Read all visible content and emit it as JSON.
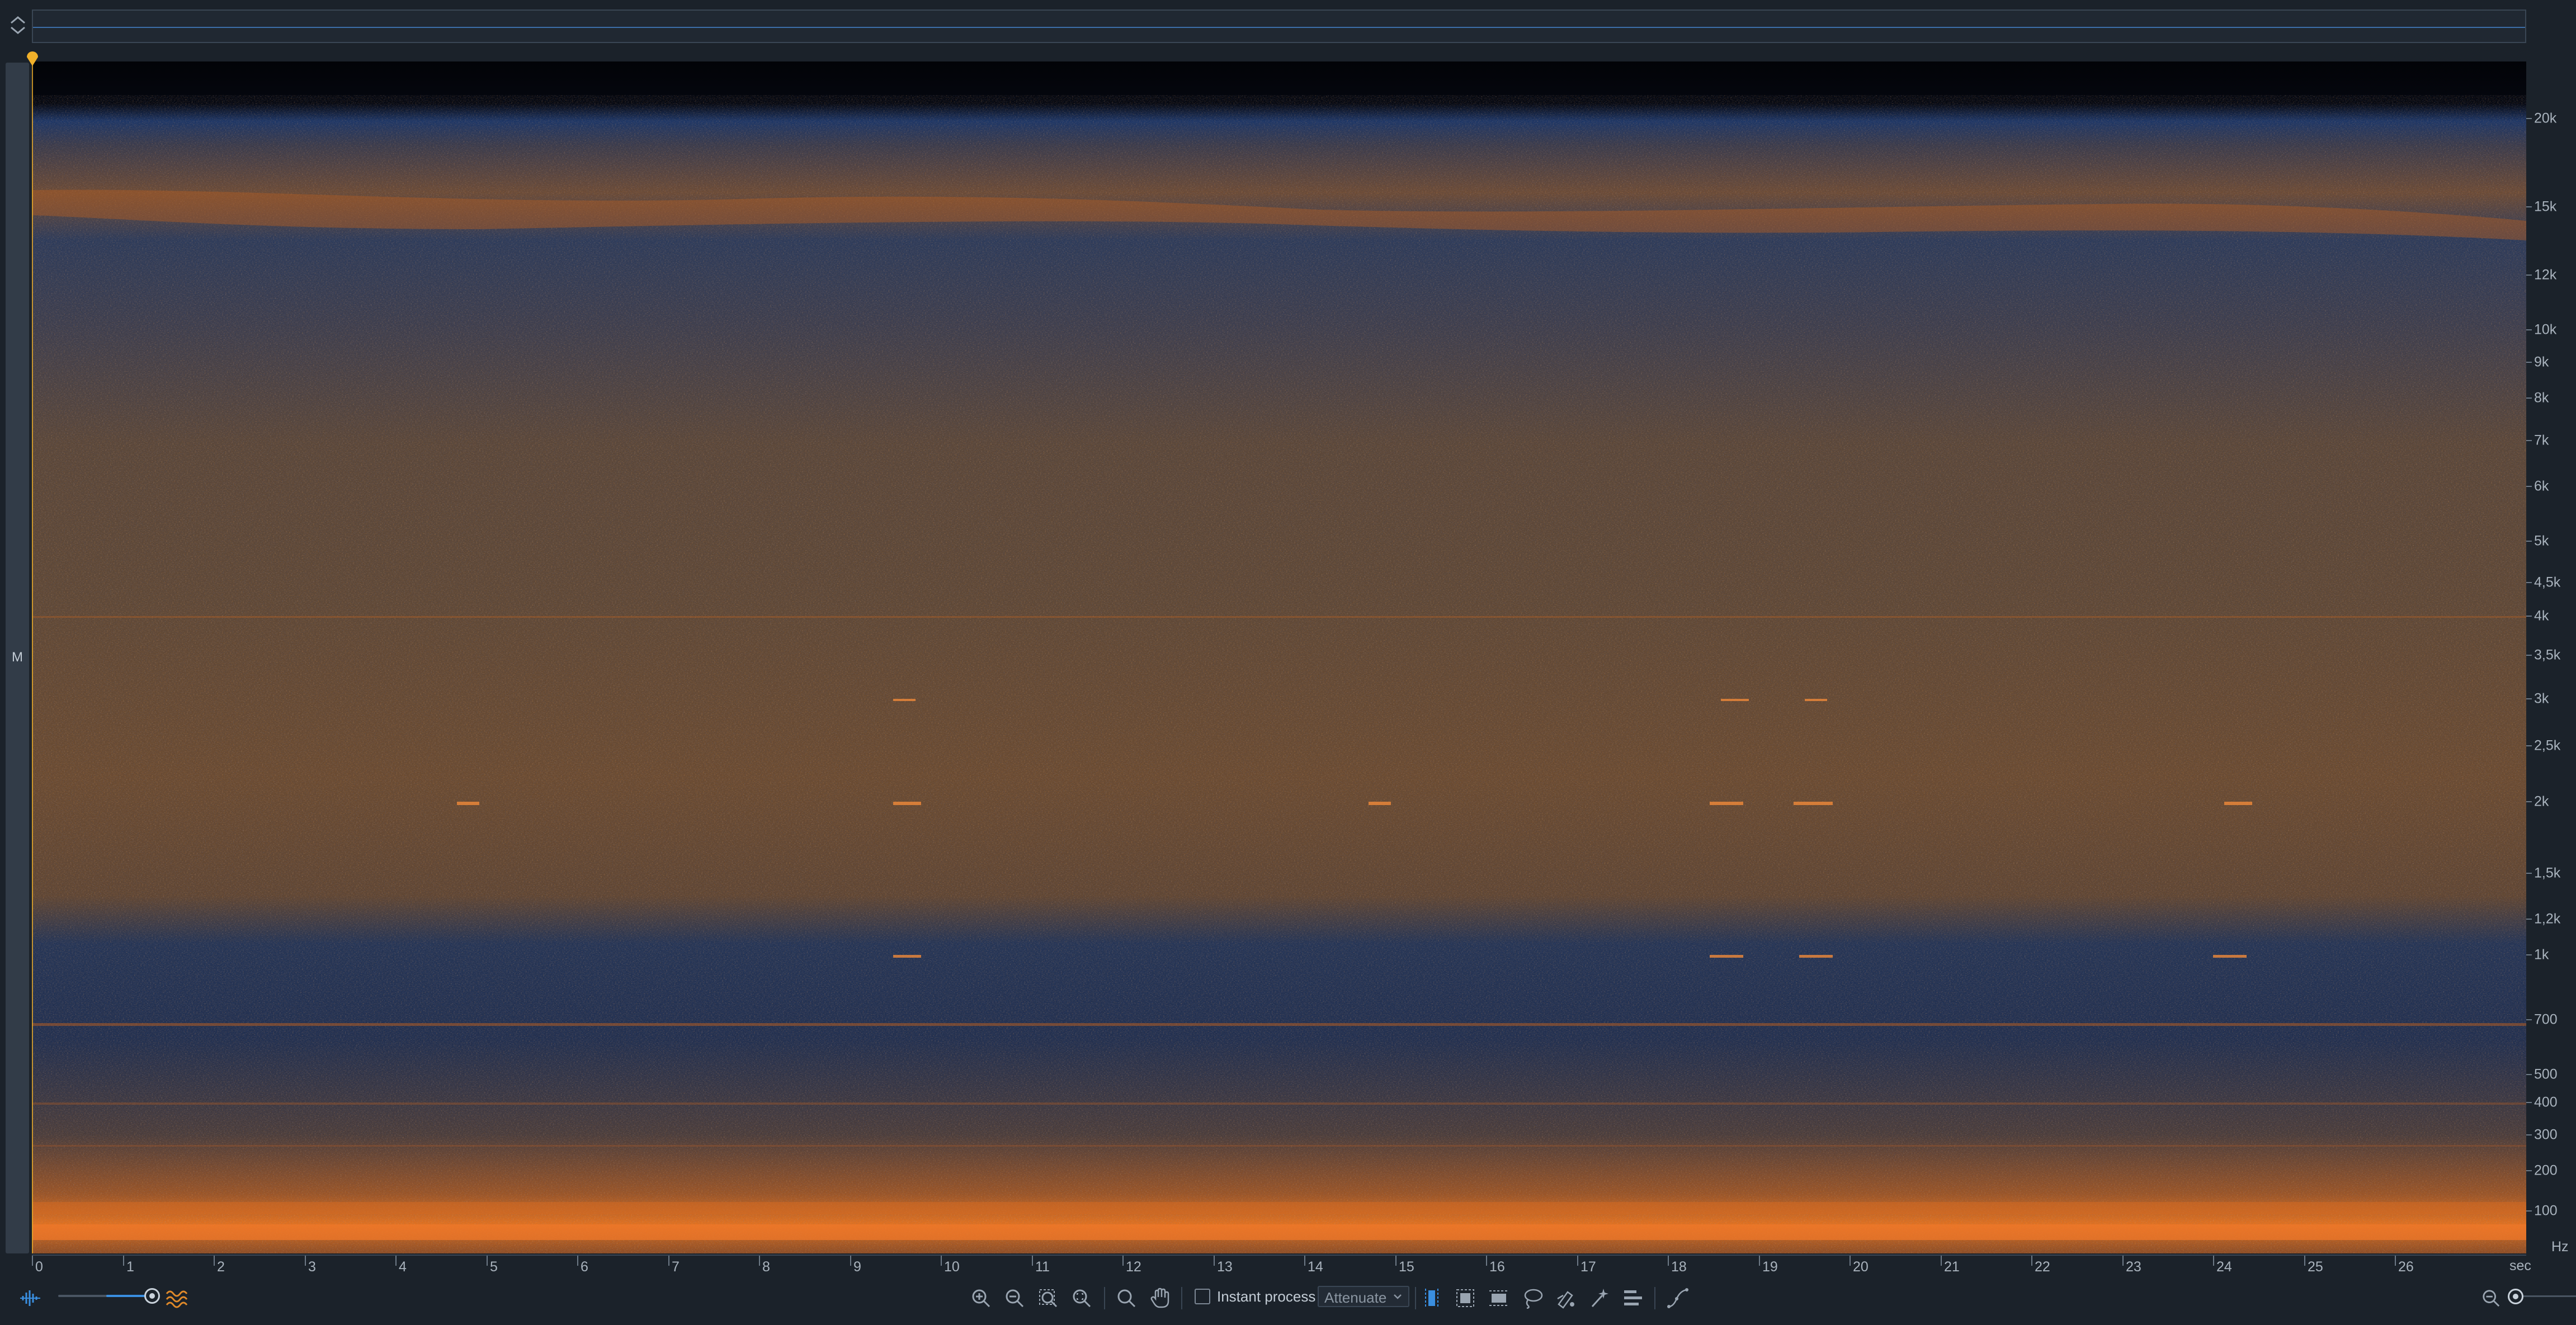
{
  "colors": {
    "background": "#1b222a",
    "spectrogram_low": "#0b0f1c",
    "spectrogram_mid": "#24395f",
    "spectrogram_high": "#e06a1c",
    "accent_blue": "#3a8fe0",
    "playhead": "#e0a52a"
  },
  "overview": {
    "toggle_icon": "expand-collapse-icon"
  },
  "track": {
    "channel_label": "M"
  },
  "freq_axis": {
    "unit": "Hz",
    "labels": [
      "20k",
      "15k",
      "12k",
      "10k",
      "9k",
      "8k",
      "7k",
      "6k",
      "5k",
      "4,5k",
      "4k",
      "3,5k",
      "3k",
      "2,5k",
      "2k",
      "1,5k",
      "1,2k",
      "1k",
      "700",
      "500",
      "400",
      "300",
      "200",
      "100"
    ]
  },
  "time_axis": {
    "unit": "sec",
    "labels": [
      "0",
      "1",
      "2",
      "3",
      "4",
      "5",
      "6",
      "7",
      "8",
      "9",
      "10",
      "11",
      "12",
      "13",
      "14",
      "15",
      "16",
      "17",
      "18",
      "19",
      "20",
      "21",
      "22",
      "23",
      "24",
      "25",
      "26"
    ]
  },
  "toolbar": {
    "left_icons": [
      "waveform-icon",
      "spectrogram-icon"
    ],
    "zoom_level": 0.5,
    "zoom_icons": [
      "zoom-in-icon",
      "zoom-out-icon",
      "zoom-selection-icon",
      "zoom-fit-icon"
    ],
    "nav_icons": [
      "magnifier-icon",
      "hand-icon"
    ],
    "instant_process_label": "Instant process",
    "instant_process_checked": false,
    "mode_value": "Attenuate",
    "selection_icons": [
      "time-selection-icon",
      "rectangle-selection-icon",
      "frequency-selection-icon",
      "lasso-icon",
      "brush-icon",
      "magic-wand-icon",
      "harmonic-selection-icon"
    ],
    "extra_icon": "curve-tool-icon",
    "right_icons": [
      "zoom-out-horizontal-icon"
    ]
  }
}
